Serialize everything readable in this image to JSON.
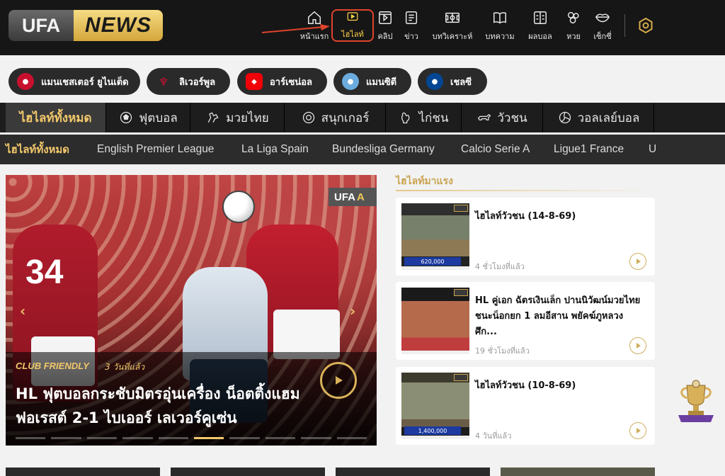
{
  "brand": {
    "ufa": "UFA",
    "news": "NEWS"
  },
  "nav": {
    "items": [
      {
        "label": "หน้าแรก",
        "icon": "home-icon"
      },
      {
        "label": "ไฮไลท์",
        "icon": "play-icon",
        "active": true
      },
      {
        "label": "คลิป",
        "icon": "clip-icon"
      },
      {
        "label": "ข่าว",
        "icon": "news-icon"
      },
      {
        "label": "บทวิเคราะห์",
        "icon": "analysis-icon"
      },
      {
        "label": "บทความ",
        "icon": "book-icon"
      },
      {
        "label": "ผลบอล",
        "icon": "scoreboard-icon"
      },
      {
        "label": "หวย",
        "icon": "lottery-icon"
      },
      {
        "label": "เซ็กซี่",
        "icon": "lips-icon"
      }
    ]
  },
  "teams": [
    {
      "label": "แมนเชสเตอร์ ยูไนเต็ด",
      "color": "#c8102e"
    },
    {
      "label": "ลิเวอร์พูล",
      "color": "#c8102e"
    },
    {
      "label": "อาร์เซน่อล",
      "color": "#ef0107"
    },
    {
      "label": "แมนซิตี",
      "color": "#6cabdd"
    },
    {
      "label": "เชลซี",
      "color": "#034694"
    }
  ],
  "categories": [
    {
      "label": "ไฮไลท์ทั้งหมด",
      "active": true
    },
    {
      "label": "ฟุตบอล",
      "icon": "football-icon"
    },
    {
      "label": "มวยไทย",
      "icon": "boxing-icon"
    },
    {
      "label": "สนุกเกอร์",
      "icon": "snooker-icon"
    },
    {
      "label": "ไก่ชน",
      "icon": "rooster-icon"
    },
    {
      "label": "วัวชน",
      "icon": "bull-icon"
    },
    {
      "label": "วอลเลย์บอล",
      "icon": "volleyball-icon"
    }
  ],
  "leagues": [
    {
      "label": "ไฮไลท์ทั้งหมด",
      "active": true
    },
    {
      "label": "English Premier League"
    },
    {
      "label": "La Liga Spain"
    },
    {
      "label": "Bundesliga Germany"
    },
    {
      "label": "Calcio Serie A"
    },
    {
      "label": "Ligue1 France"
    },
    {
      "label": "U"
    }
  ],
  "hero": {
    "tag": "CLUB FRIENDLY",
    "time": "3 วันที่แล้ว",
    "title": "HL ฟุตบอลกระชับมิตรอุ่นเครื่อง น็อตติ้งแฮม ฟอเรสต์ 2-1 ไบเออร์ เลเวอร์คูเซ่น",
    "player_number": "34",
    "watermark_ufa": "UFA",
    "watermark_a": "A"
  },
  "trending": {
    "title": "ไฮไลท์มาแรง",
    "items": [
      {
        "title": "ไฮไลท์วัวชน (14-8-69)",
        "time": "4 ชั่วโมงที่แล้ว",
        "thumb_label": "620,000"
      },
      {
        "title": "HL คู่เอก ฉัตรเงินเล็ก ปานนิวัฒน์มวยไทย ชนะน็อกยก 1 ลมอีสาน พยัคฆ์ภูหลวง ศึก...",
        "time": "19 ชั่วโมงที่แล้ว",
        "thumb_label": ""
      },
      {
        "title": "ไฮไลท์วัวชน (10-8-69)",
        "time": "4 วันที่แล้ว",
        "thumb_label": "1,400,000"
      }
    ]
  },
  "colors": {
    "accent": "#f2c86b",
    "header_bg": "#161616",
    "active_border": "#e0432d"
  }
}
